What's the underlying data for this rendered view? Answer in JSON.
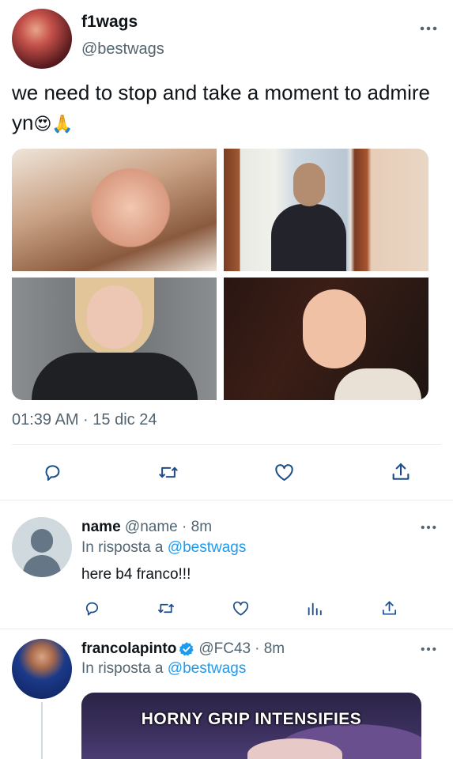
{
  "tweet": {
    "display_name": "f1wags",
    "handle": "@bestwags",
    "text": "we need to stop and take a moment to admire yn",
    "emojis": "😍🙏",
    "timestamp": "01:39 AM · 15 dic 24"
  },
  "replies": [
    {
      "display_name": "name",
      "handle": "@name",
      "time": "· 8m",
      "in_reply_prefix": "In risposta a",
      "in_reply_to": "@bestwags",
      "text": "here b4 franco!!!"
    },
    {
      "display_name": "francolapinto",
      "handle": "@FC43",
      "time": "· 8m",
      "in_reply_prefix": "In risposta a",
      "in_reply_to": "@bestwags",
      "gif_caption": "HORNY GRIP INTENSIFIES"
    }
  ],
  "colors": {
    "accent": "#1d9bf0",
    "muted": "#536471",
    "icon": "#1d4e89"
  }
}
